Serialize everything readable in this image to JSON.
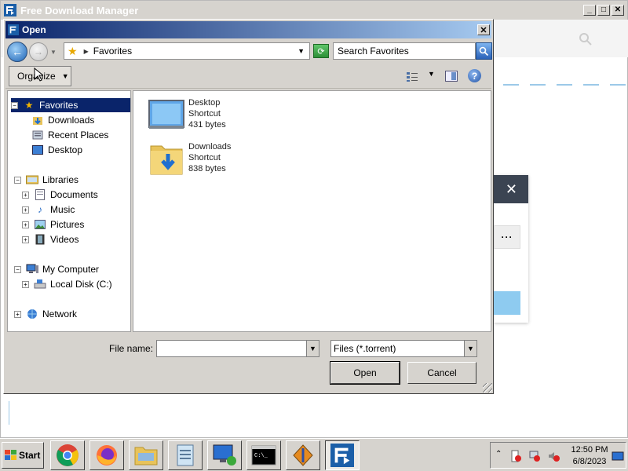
{
  "app": {
    "title": "Free Download Manager"
  },
  "dialog": {
    "title": "Open",
    "address": "Favorites",
    "search_placeholder": "Search Favorites",
    "organize_label": "Organize"
  },
  "tree": {
    "favorites": "Favorites",
    "downloads": "Downloads",
    "recent_places": "Recent Places",
    "desktop": "Desktop",
    "libraries": "Libraries",
    "documents": "Documents",
    "music": "Music",
    "pictures": "Pictures",
    "videos": "Videos",
    "my_computer": "My Computer",
    "local_disk": "Local Disk (C:)",
    "network": "Network"
  },
  "files": [
    {
      "name": "Desktop",
      "type": "Shortcut",
      "size": "431 bytes"
    },
    {
      "name": "Downloads",
      "type": "Shortcut",
      "size": "838 bytes"
    }
  ],
  "form": {
    "file_name_label": "File name:",
    "file_name_value": "",
    "file_type": "Files (*.torrent)",
    "open_label": "Open",
    "cancel_label": "Cancel"
  },
  "taskbar": {
    "start_label": "Start",
    "time": "12:50 PM",
    "date": "6/8/2023"
  }
}
